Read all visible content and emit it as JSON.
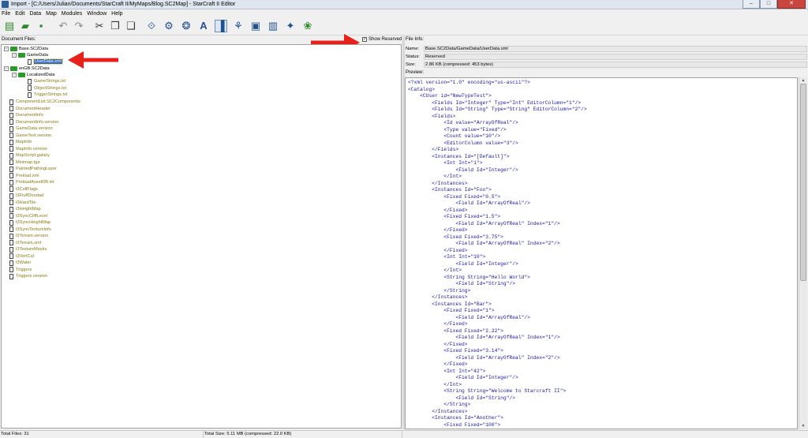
{
  "window": {
    "title": "Import - [C:/Users/Julian/Documents/StarCraft II/MyMaps/Blog.SC2Map] - StarCraft II Editor",
    "buttons": {
      "minimize": "–",
      "maximize": "□",
      "close": "✕"
    }
  },
  "menu": [
    "File",
    "Edit",
    "Data",
    "Map",
    "Modules",
    "Window",
    "Help"
  ],
  "toolbar": {
    "icons": [
      "new-file-icon",
      "open-folder-icon",
      "save-icon",
      "undo-icon",
      "redo-icon",
      "cut-icon",
      "copy-icon",
      "paste-icon",
      "terrain-editor-icon",
      "triggers-icon",
      "data-editor-icon",
      "text-editor-icon",
      "import-editor-icon",
      "cutscene-icon",
      "ai-icon",
      "sound-icon",
      "preview-icon",
      "unit-editor-icon"
    ],
    "glyphs": [
      "▤",
      "▰",
      "▪",
      "↶",
      "↷",
      "✂",
      "❐",
      "❏",
      "⟐",
      "⚙",
      "❂",
      "A",
      "▐",
      "⚘",
      "▣",
      "▥",
      "✦",
      "❀"
    ]
  },
  "left": {
    "label": "Document Files:",
    "show_reserved_label": "Show Reserved",
    "show_reserved_checked": "✓",
    "tree": [
      {
        "label": "Base.SC2Data",
        "type": "folder",
        "expanded": true
      },
      {
        "label": "GameData",
        "type": "folder",
        "expanded": true
      },
      {
        "label": "UserData.xml",
        "type": "file",
        "selected": true
      },
      {
        "label": "enGB.SC2Data",
        "type": "folder",
        "expanded": true
      },
      {
        "label": "LocalizedData",
        "type": "folder",
        "expanded": true
      },
      {
        "label": "GameStrings.txt",
        "type": "file"
      },
      {
        "label": "ObjectStrings.txt",
        "type": "file"
      },
      {
        "label": "TriggerStrings.txt",
        "type": "file"
      },
      {
        "label": "ComponentList.SC2Components",
        "type": "file"
      },
      {
        "label": "DocumentHeader",
        "type": "file"
      },
      {
        "label": "DocumentInfo",
        "type": "file"
      },
      {
        "label": "DocumentInfo.version",
        "type": "file"
      },
      {
        "label": "GameData.version",
        "type": "file"
      },
      {
        "label": "GameText.version",
        "type": "file"
      },
      {
        "label": "MapInfo",
        "type": "file"
      },
      {
        "label": "MapInfo.version",
        "type": "file"
      },
      {
        "label": "MapScript.galaxy",
        "type": "file"
      },
      {
        "label": "Minimap.tga",
        "type": "file"
      },
      {
        "label": "PaintedPathingLayer",
        "type": "file"
      },
      {
        "label": "Preload.xml",
        "type": "file"
      },
      {
        "label": "PreloadAssetDB.txt",
        "type": "file"
      },
      {
        "label": "t3CellFlags",
        "type": "file"
      },
      {
        "label": "t3FluffDoodad",
        "type": "file"
      },
      {
        "label": "t3HardTile",
        "type": "file"
      },
      {
        "label": "t3HeightMap",
        "type": "file"
      },
      {
        "label": "t3SyncCliffLevel",
        "type": "file"
      },
      {
        "label": "t3SyncHeightMap",
        "type": "file"
      },
      {
        "label": "t3SyncTextureInfo",
        "type": "file"
      },
      {
        "label": "t3Terrain.version",
        "type": "file"
      },
      {
        "label": "t3Terrain.xml",
        "type": "file"
      },
      {
        "label": "t3TextureMasks",
        "type": "file"
      },
      {
        "label": "t3VertCol",
        "type": "file"
      },
      {
        "label": "t3Water",
        "type": "file"
      },
      {
        "label": "Triggers",
        "type": "file"
      },
      {
        "label": "Triggers.version",
        "type": "file"
      }
    ]
  },
  "right": {
    "label": "File Info:",
    "name_key": "Name:",
    "name": "Base.SC2Data/GameData/UserData.xml",
    "status_key": "Status:",
    "status": "Reserved",
    "size_key": "Size:",
    "size": "2.86 KB (compressed: 453 bytes)",
    "preview_label": "Preview:",
    "code": [
      "<?xml version=\"1.0\" encoding=\"us-ascii\"?>",
      "<Catalog>",
      "    <CUser id=\"NewTypeTest\">",
      "        <Fields Id=\"Integer\" Type=\"Int\" EditorColumn=\"1\"/>",
      "        <Fields Id=\"String\" Type=\"String\" EditorColumn=\"2\"/>",
      "        <Fields>",
      "            <Id value=\"ArrayOfReal\"/>",
      "            <Type value=\"Fixed\"/>",
      "            <Count value=\"10\"/>",
      "            <EditorColumn value=\"3\"/>",
      "        </Fields>",
      "        <Instances Id=\"[Default]\">",
      "            <Int Int=\"1\">",
      "                <Field Id=\"Integer\"/>",
      "            </Int>",
      "        </Instances>",
      "        <Instances Id=\"Foo\">",
      "            <Fixed Fixed=\"0.5\">",
      "                <Field Id=\"ArrayOfReal\"/>",
      "            </Fixed>",
      "            <Fixed Fixed=\"1.5\">",
      "                <Field Id=\"ArrayOfReal\" Index=\"1\"/>",
      "            </Fixed>",
      "            <Fixed Fixed=\"3.75\">",
      "                <Field Id=\"ArrayOfReal\" Index=\"2\"/>",
      "            </Fixed>",
      "            <Int Int=\"10\">",
      "                <Field Id=\"Integer\"/>",
      "            </Int>",
      "            <String String=\"Hello World\">",
      "                <Field Id=\"String\"/>",
      "            </String>",
      "        </Instances>",
      "        <Instances Id=\"Bar\">",
      "            <Fixed Fixed=\"1\">",
      "                <Field Id=\"ArrayOfReal\"/>",
      "            </Fixed>",
      "            <Fixed Fixed=\"2.22\">",
      "                <Field Id=\"ArrayOfReal\" Index=\"1\"/>",
      "            </Fixed>",
      "            <Fixed Fixed=\"3.14\">",
      "                <Field Id=\"ArrayOfReal\" Index=\"2\"/>",
      "            </Fixed>",
      "            <Int Int=\"42\">",
      "                <Field Id=\"Integer\"/>",
      "            </Int>",
      "            <String String=\"Welcome to Starcraft II\">",
      "                <Field Id=\"String\"/>",
      "            </String>",
      "        </Instances>",
      "        <Instances Id=\"Another\">",
      "            <Fixed Fixed=\"100\">"
    ]
  },
  "statusbar": {
    "total_files": "Total Files: 31",
    "total_size": "Total Size: 5.11 MB (compressed: 22.0 KB)"
  },
  "colors": {
    "annotation_arrow": "#e8201c",
    "tree_folder": "#2a9a2a",
    "selection": "#3169c6"
  }
}
